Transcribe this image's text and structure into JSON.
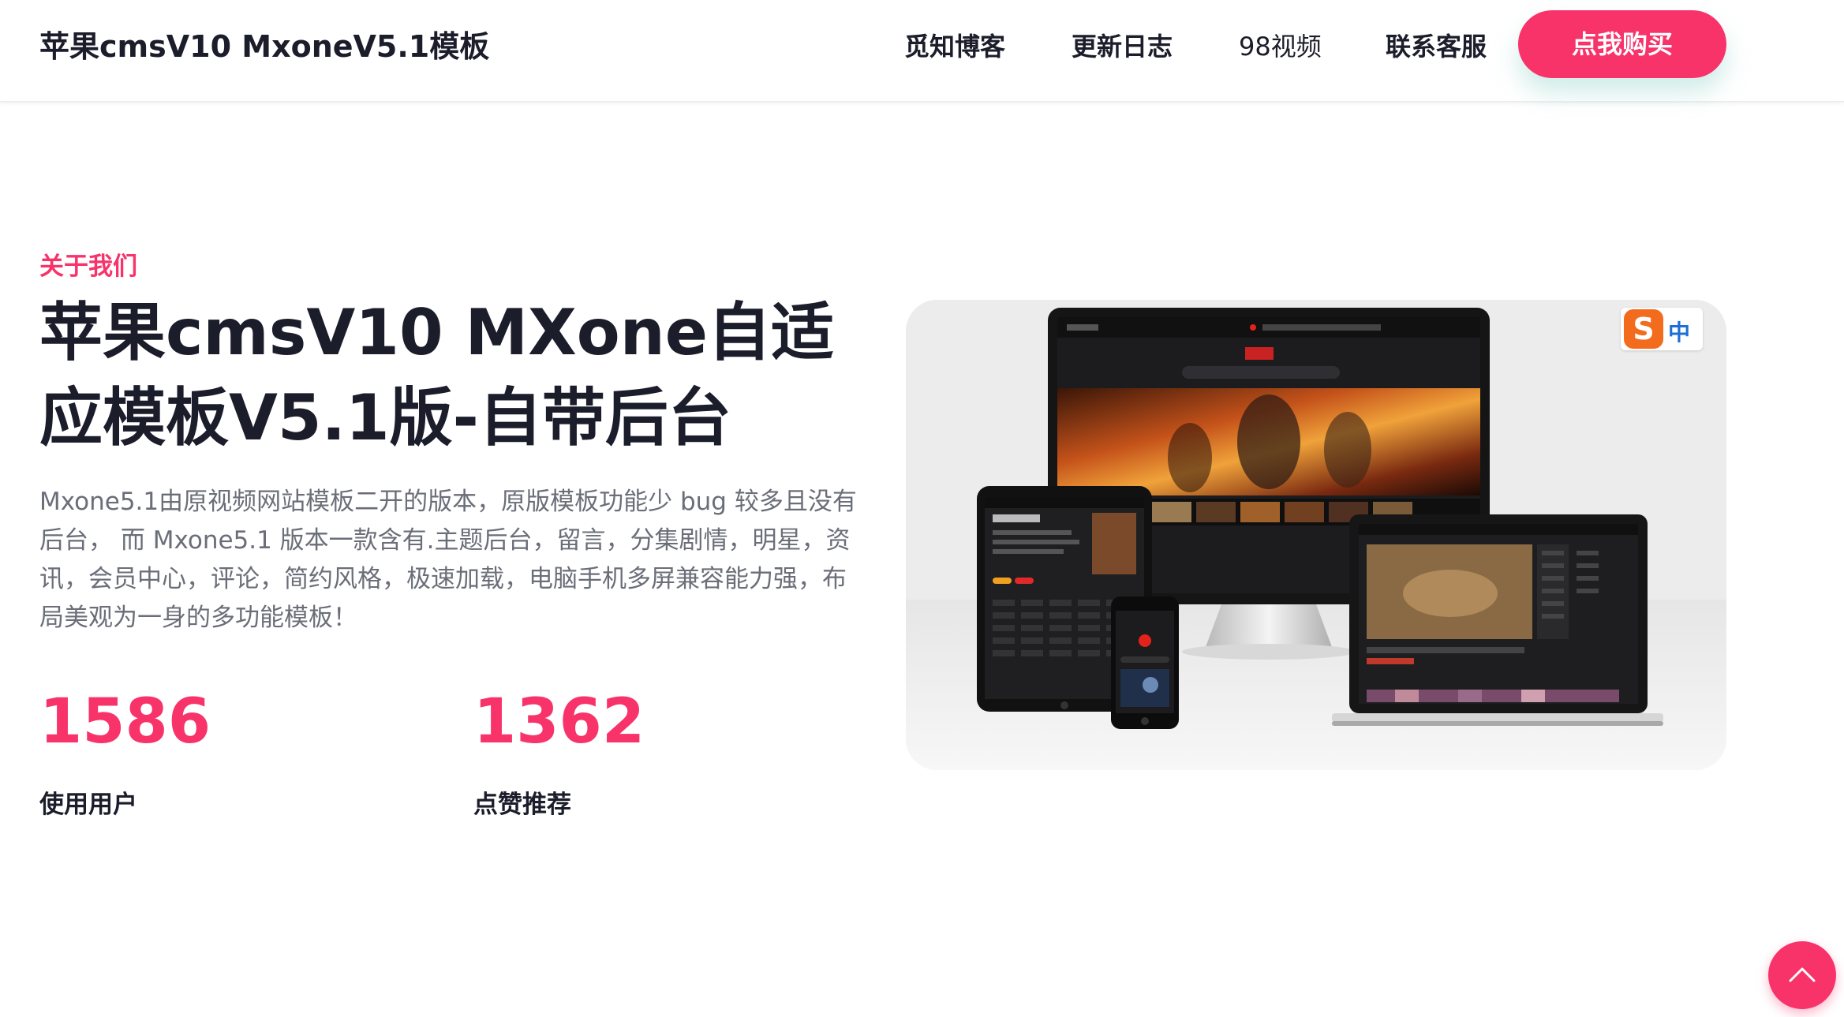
{
  "header": {
    "brand": "苹果cmsV10 MxoneV5.1模板",
    "nav": [
      {
        "label": "觅知博客"
      },
      {
        "label": "更新日志"
      },
      {
        "label": "98视频"
      },
      {
        "label": "联系客服"
      }
    ],
    "buy_label": "点我购买"
  },
  "hero": {
    "section_label": "关于我们",
    "title": "苹果cmsV10 MXone自适应模板V5.1版-自带后台",
    "description": "Mxone5.1由原视频网站模板二开的版本，原版模板功能少 bug 较多且没有后台， 而 Mxone5.1 版本一款含有.主题后台，留言，分集剧情，明星，资讯，会员中心，评论，简约风格，极速加载，电脑手机多屏兼容能力强，布局美观为一身的多功能模板！",
    "stats": [
      {
        "value": "1586",
        "label": "使用用户"
      },
      {
        "value": "1362",
        "label": "点赞推荐"
      }
    ]
  },
  "mockup": {
    "ime_badge_text": "中",
    "ime_badge_logo": "S"
  },
  "colors": {
    "accent": "#f7336a",
    "text_dark": "#1c1d2b",
    "text_muted": "#6b6e78"
  },
  "icons": {
    "back_to_top": "chevron-up-icon",
    "ime": "sogou-ime-icon"
  }
}
